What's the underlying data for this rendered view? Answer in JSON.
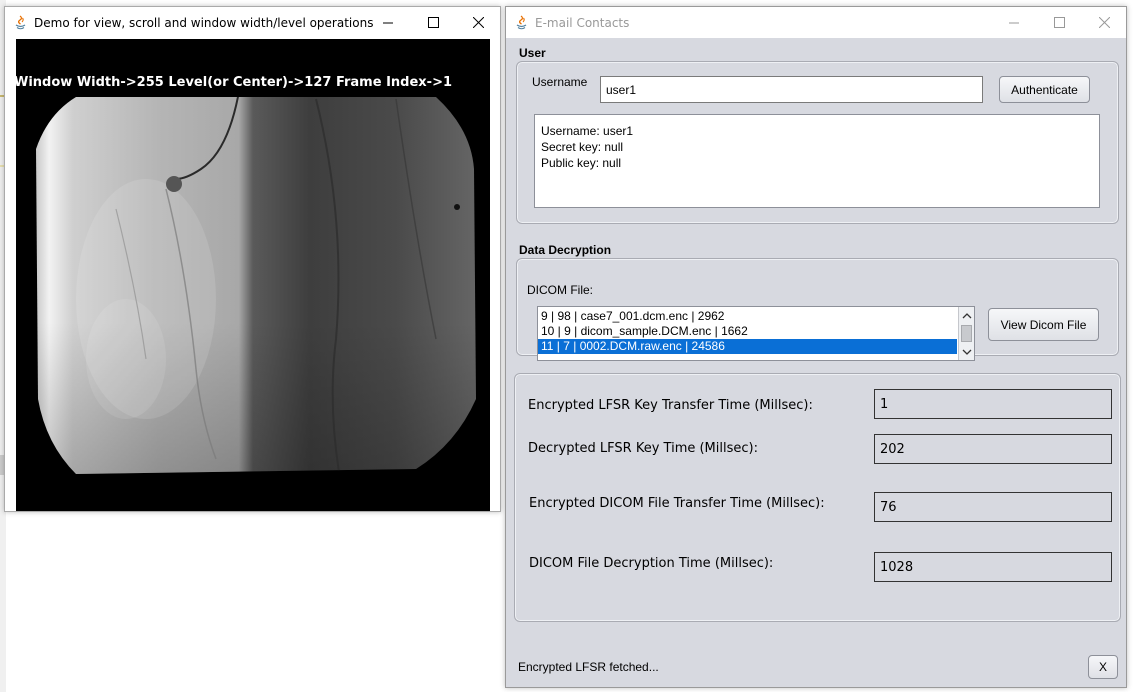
{
  "viewer_window": {
    "title": "Demo for view, scroll and window width/level operations",
    "overlay": "Window Width->255 Level(or Center)->127 Frame Index->1",
    "image": "x-ray-angiography-frame"
  },
  "contacts_window": {
    "title": "E-mail Contacts",
    "user_section": {
      "heading": "User",
      "username_label": "Username",
      "username_value": "user1",
      "authenticate_label": "Authenticate",
      "info_lines": [
        "Username: user1",
        "Secret key: null",
        "Public key: null"
      ]
    },
    "decryption_section": {
      "heading": "Data Decryption",
      "file_label": "DICOM File:",
      "files": [
        "9 | 98 | case7_001.dcm.enc | 2962",
        "10 | 9 | dicom_sample.DCM.enc | 1662",
        "11 | 7 | 0002.DCM.raw.enc | 24586"
      ],
      "selected_index": 2,
      "view_button_label": "View Dicom File"
    },
    "metrics": [
      {
        "label": "Encrypted LFSR Key Transfer Time (Millsec):",
        "value": "1"
      },
      {
        "label": "Decrypted LFSR Key Time (Millsec):",
        "value": "202"
      },
      {
        "label": "Encrypted DICOM File Transfer Time (Millsec):",
        "value": "76"
      },
      {
        "label": "DICOM File Decryption Time (Millsec):",
        "value": "1028"
      }
    ],
    "status_text": "Encrypted LFSR fetched...",
    "close_label": "X"
  },
  "colors": {
    "panel_bg": "#d7d9e0",
    "selection": "#0a6fd6"
  }
}
